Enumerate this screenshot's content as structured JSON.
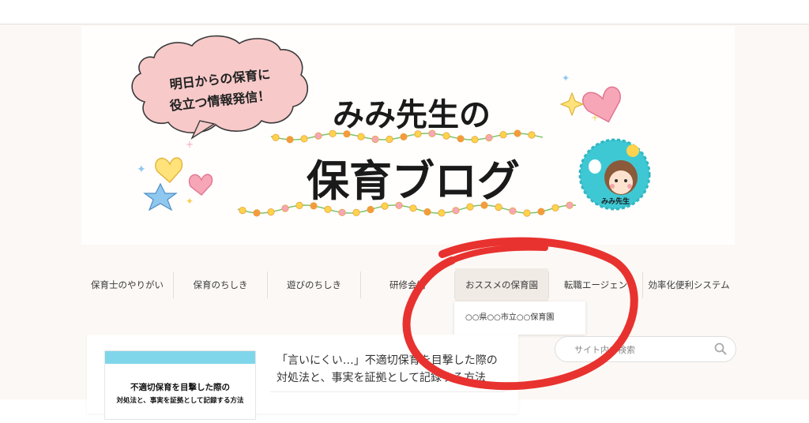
{
  "header": {
    "bubble_line1": "明日からの保育に",
    "bubble_line2": "役立つ情報発信！",
    "title_line1": "みみ先生の",
    "title_line2": "保育ブログ",
    "avatar_label": "みみ先生"
  },
  "nav": {
    "items": [
      {
        "label": "保育士のやりがい"
      },
      {
        "label": "保育のちしき"
      },
      {
        "label": "遊びのちしき"
      },
      {
        "label": "研修会情"
      },
      {
        "label": "おススメの保育園"
      },
      {
        "label": "転職エージェン"
      },
      {
        "label": "効率化便利システム"
      }
    ],
    "dropdown": {
      "item": "○○県○○市立○○保育園"
    }
  },
  "article": {
    "thumb_line1": "不適切保育を目撃した際の",
    "thumb_line2": "対処法と、事実を証拠として記録する方法",
    "title": "「言いにくい…」不適切保育を目撃した際の対処法と、事実を証拠として記録する方法"
  },
  "search": {
    "placeholder": "サイト内を検索"
  },
  "colors": {
    "accent_red": "#e8322f",
    "cyan": "#7fd6ea",
    "pink_bubble": "#f7c9c9"
  }
}
